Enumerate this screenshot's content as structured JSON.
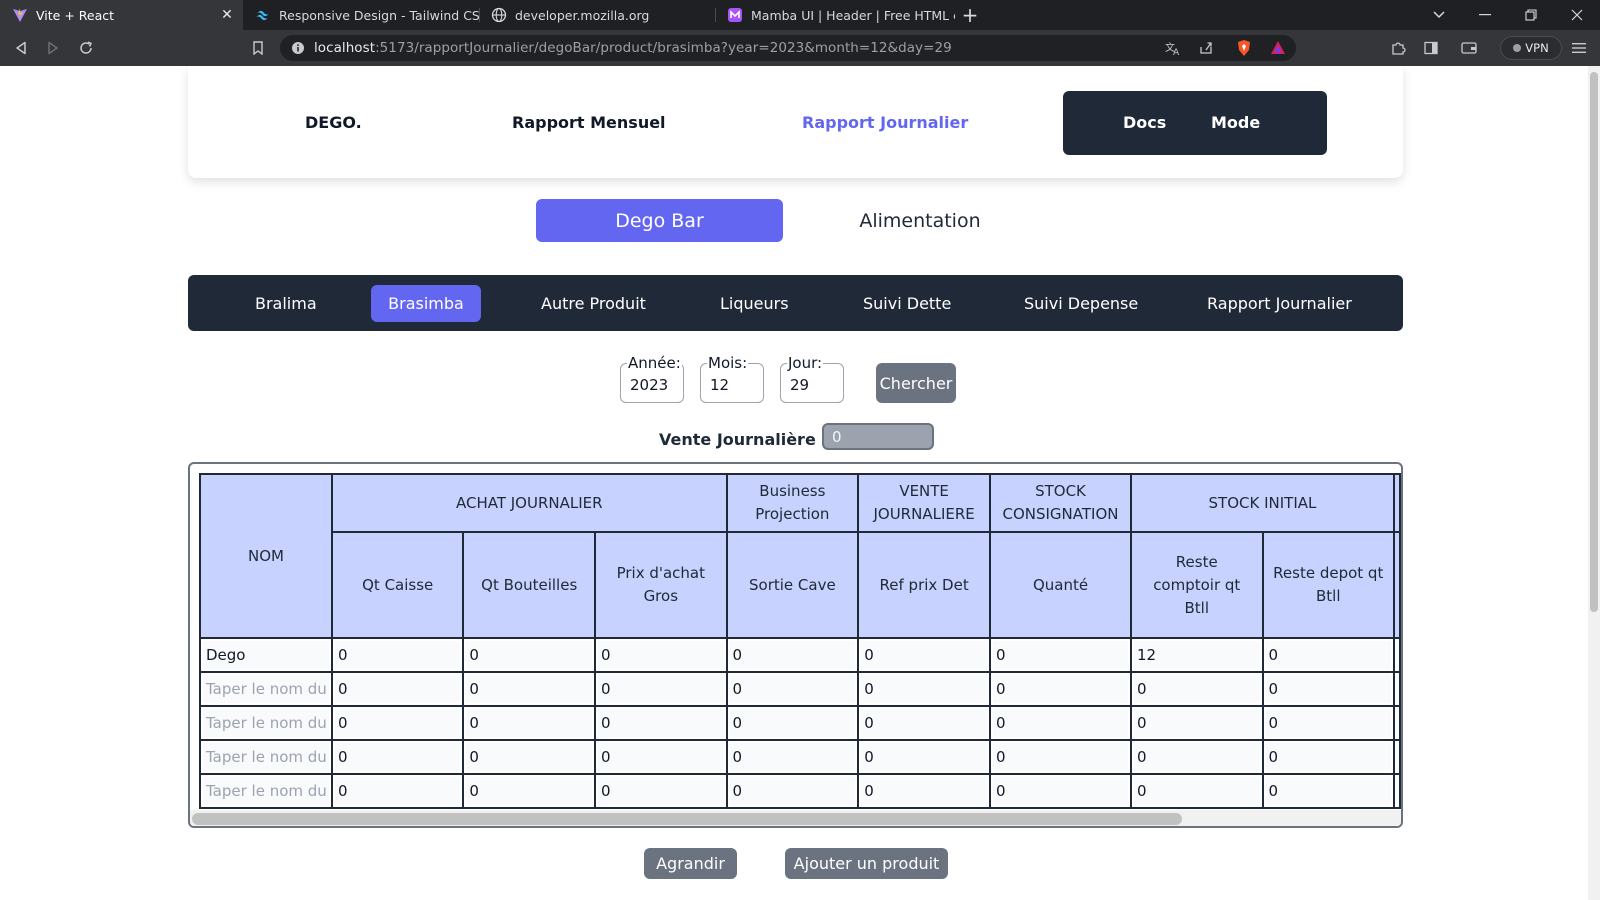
{
  "browser": {
    "tabs": [
      {
        "title": "Vite + React",
        "active": true,
        "icon": "vite-icon"
      },
      {
        "title": "Responsive Design - Tailwind CSS",
        "active": false,
        "icon": "tailwind-icon"
      },
      {
        "title": "developer.mozilla.org",
        "active": false,
        "icon": "globe-icon"
      },
      {
        "title": "Mamba UI | Header | Free HTML comp",
        "active": false,
        "icon": "mamba-icon"
      }
    ],
    "url_host": "localhost",
    "url_rest": ":5173/rapportJournalier/degoBar/product/brasimba?year=2023&month=12&day=29",
    "vpn_label": "VPN"
  },
  "nav": {
    "brand": "DEGO.",
    "link_mensuel": "Rapport Mensuel",
    "link_journalier": "Rapport Journalier",
    "docs": "Docs",
    "mode": "Mode"
  },
  "sections": {
    "active": "Dego Bar",
    "other": "Alimentation"
  },
  "categories": [
    "Bralima",
    "Brasimba",
    "Autre Produit",
    "Liqueurs",
    "Suivi Dette",
    "Suivi Depense",
    "Rapport Journalier"
  ],
  "active_category": "Brasimba",
  "filters": {
    "year_label": "Année:",
    "year_value": "2023",
    "month_label": "Mois:",
    "month_value": "12",
    "day_label": "Jour:",
    "day_value": "29",
    "search_button": "Chercher"
  },
  "daily_sale": {
    "label": "Vente Journalière",
    "value": "0"
  },
  "table": {
    "group_headers": {
      "nom": "NOM",
      "achat": "ACHAT JOURNALIER",
      "business_1": "Business",
      "business_2": "Projection",
      "vente_1": "VENTE",
      "vente_2": "JOURNALIERE",
      "stock_cons_1": "STOCK",
      "stock_cons_2": "CONSIGNATION",
      "stock_initial": "STOCK INITIAL"
    },
    "sub_headers": {
      "qt_caisse": "Qt Caisse",
      "qt_bouteilles": "Qt Bouteilles",
      "prix_1": "Prix d'achat",
      "prix_2": "Gros",
      "sortie_cave": "Sortie Cave",
      "ref_prix": "Ref prix Det",
      "quante": "Quanté",
      "reste_comptoir_1": "Reste",
      "reste_comptoir_2": "comptoir qt",
      "reste_comptoir_3": "Btll",
      "reste_depot_1": "Reste depot qt",
      "reste_depot_2": "Btll"
    },
    "name_placeholder": "Taper le nom du",
    "rows": [
      {
        "name": "Dego",
        "values": [
          "0",
          "0",
          "0",
          "0",
          "0",
          "0",
          "12",
          "0"
        ]
      },
      {
        "name": "",
        "values": [
          "0",
          "0",
          "0",
          "0",
          "0",
          "0",
          "0",
          "0"
        ]
      },
      {
        "name": "",
        "values": [
          "0",
          "0",
          "0",
          "0",
          "0",
          "0",
          "0",
          "0"
        ]
      },
      {
        "name": "",
        "values": [
          "0",
          "0",
          "0",
          "0",
          "0",
          "0",
          "0",
          "0"
        ]
      },
      {
        "name": "",
        "values": [
          "0",
          "0",
          "0",
          "0",
          "0",
          "0",
          "0",
          "0"
        ]
      }
    ]
  },
  "actions": {
    "enlarge": "Agrandir",
    "add_product": "Ajouter un produit"
  }
}
